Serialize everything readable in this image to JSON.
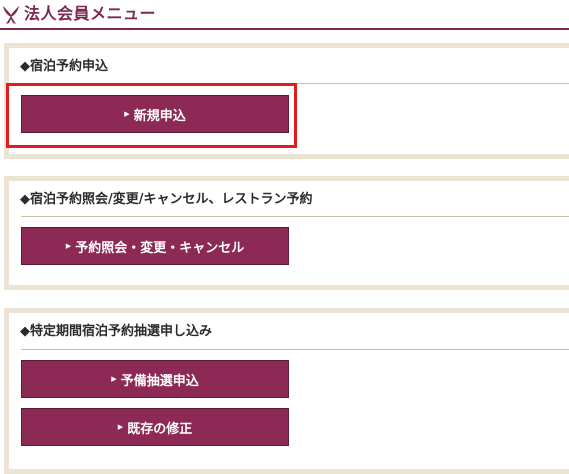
{
  "header": {
    "title": "法人会員メニュー",
    "logo_icon": "ribbon-logo-icon"
  },
  "sections": [
    {
      "title": "◆宿泊予約申込",
      "buttons": [
        "新規申込"
      ]
    },
    {
      "title": "◆宿泊予約照会/変更/キャンセル、レストラン予約",
      "buttons": [
        "予約照会・変更・キャンセル"
      ]
    },
    {
      "title": "◆特定期間宿泊予約抽選申し込み",
      "buttons": [
        "予備抽選申込",
        "既存の修正"
      ]
    }
  ],
  "arrow_glyph": "▶",
  "colors": {
    "accent": "#7a2a52",
    "button": "#8c2a55",
    "frame": "#ece3d3",
    "highlight": "#e21b1b"
  }
}
